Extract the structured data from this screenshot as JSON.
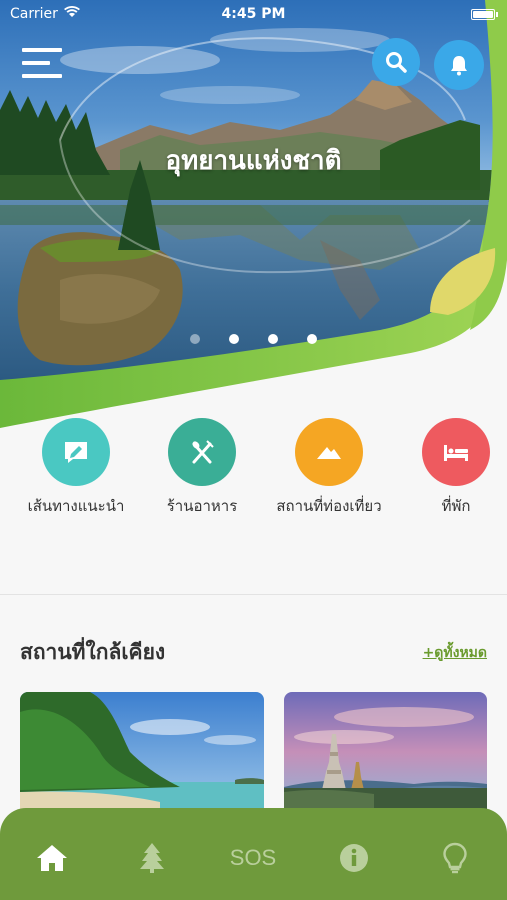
{
  "status_bar": {
    "carrier": "Carrier",
    "time": "4:45 PM"
  },
  "hero": {
    "title": "อุทยานแห่งชาติ",
    "slides": 4,
    "active_slide": 1
  },
  "header": {
    "menu_icon": "hamburger-menu-icon",
    "search_icon": "search-icon",
    "notification_icon": "bell-icon"
  },
  "categories": [
    {
      "label": "เส้นทางแนะนำ",
      "icon": "route-note-icon",
      "color": "#4ac8c2"
    },
    {
      "label": "ร้านอาหาร",
      "icon": "fork-spoon-icon",
      "color": "#3aae96"
    },
    {
      "label": "สถานที่ท่องเที่ยว",
      "icon": "mountain-icon",
      "color": "#f5a623"
    },
    {
      "label": "ที่พัก",
      "icon": "bed-icon",
      "color": "#ee5a5f"
    }
  ],
  "nearby": {
    "title": "สถานที่ใกล้เคียง",
    "see_all": "+ดูทั้งหมด"
  },
  "tabbar": {
    "items": [
      {
        "name": "home",
        "icon": "home-icon",
        "active": true
      },
      {
        "name": "forest",
        "icon": "tree-icon",
        "active": false
      },
      {
        "name": "sos",
        "label": "SOS",
        "active": false
      },
      {
        "name": "info",
        "icon": "info-icon",
        "active": false
      },
      {
        "name": "tips",
        "icon": "lightbulb-icon",
        "active": false
      }
    ]
  },
  "colors": {
    "brand_green": "#6f9a3c",
    "hero_green": "#7cc243",
    "button_blue": "#3aa8e8"
  }
}
